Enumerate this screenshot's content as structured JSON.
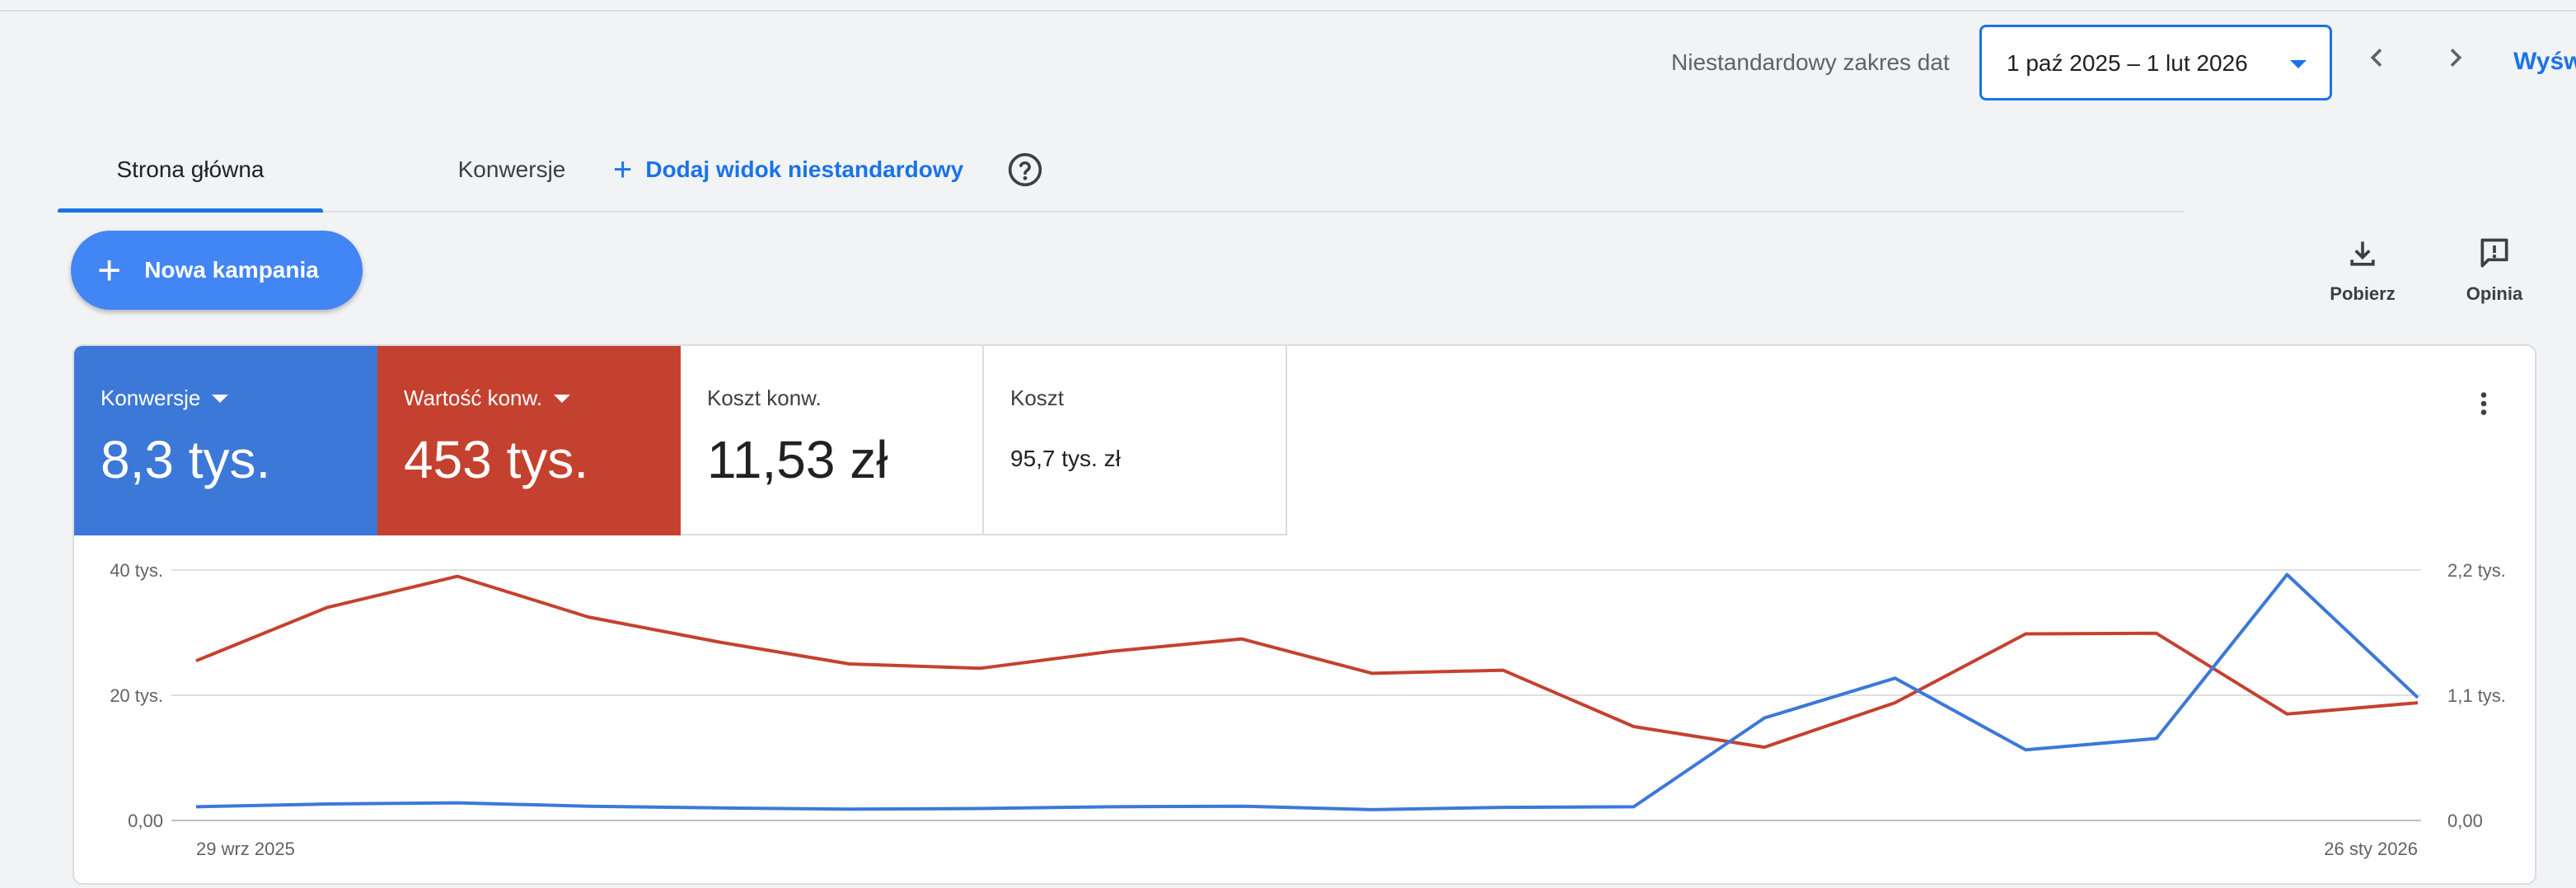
{
  "header": {
    "date_range_label": "Niestandardowy zakres dat",
    "date_range_value": "1 paź 2025 – 1 lut 2026",
    "view_link": "Wyśw"
  },
  "tabs": [
    {
      "label": "Strona główna",
      "active": true
    },
    {
      "label": "Konwersje",
      "active": false
    }
  ],
  "add_view_label": "Dodaj widok niestandardowy",
  "new_campaign_label": "Nowa kampania",
  "tools": {
    "download_label": "Pobierz",
    "feedback_label": "Opinia"
  },
  "metrics": [
    {
      "label": "Konwersje",
      "value": "8,3 tys.",
      "color": "#3c78d8",
      "dropdown": true
    },
    {
      "label": "Wartość konw.",
      "value": "453 tys.",
      "color": "#c5412f",
      "dropdown": true
    },
    {
      "label": "Koszt konw.",
      "value": "11,53 zł"
    },
    {
      "label": "Koszt",
      "value": "95,7 tys. zł"
    }
  ],
  "chart_data": {
    "type": "line",
    "x_start_label": "29 wrz 2025",
    "x_end_label": "26 sty 2026",
    "left_axis": {
      "ticks": [
        "0,00",
        "20 tys.",
        "40 tys."
      ],
      "ylim": [
        0,
        40000
      ]
    },
    "right_axis": {
      "ticks": [
        "0,00",
        "1,1 tys.",
        "2,2 tys."
      ],
      "ylim": [
        0,
        2200
      ]
    },
    "grid": true,
    "series": [
      {
        "name": "Wartość konw.",
        "color": "#c5412f",
        "axis": "left",
        "values": [
          25500,
          34000,
          39000,
          32500,
          28500,
          25000,
          24300,
          27000,
          29000,
          23500,
          24000,
          15000,
          11700,
          18800,
          29800,
          29900,
          17000,
          18800
        ]
      },
      {
        "name": "Konwersje",
        "color": "#3c78d8",
        "axis": "right",
        "values": [
          120,
          145,
          155,
          125,
          110,
          100,
          105,
          120,
          125,
          95,
          115,
          120,
          900,
          1250,
          620,
          720,
          2160,
          1080
        ]
      }
    ]
  }
}
